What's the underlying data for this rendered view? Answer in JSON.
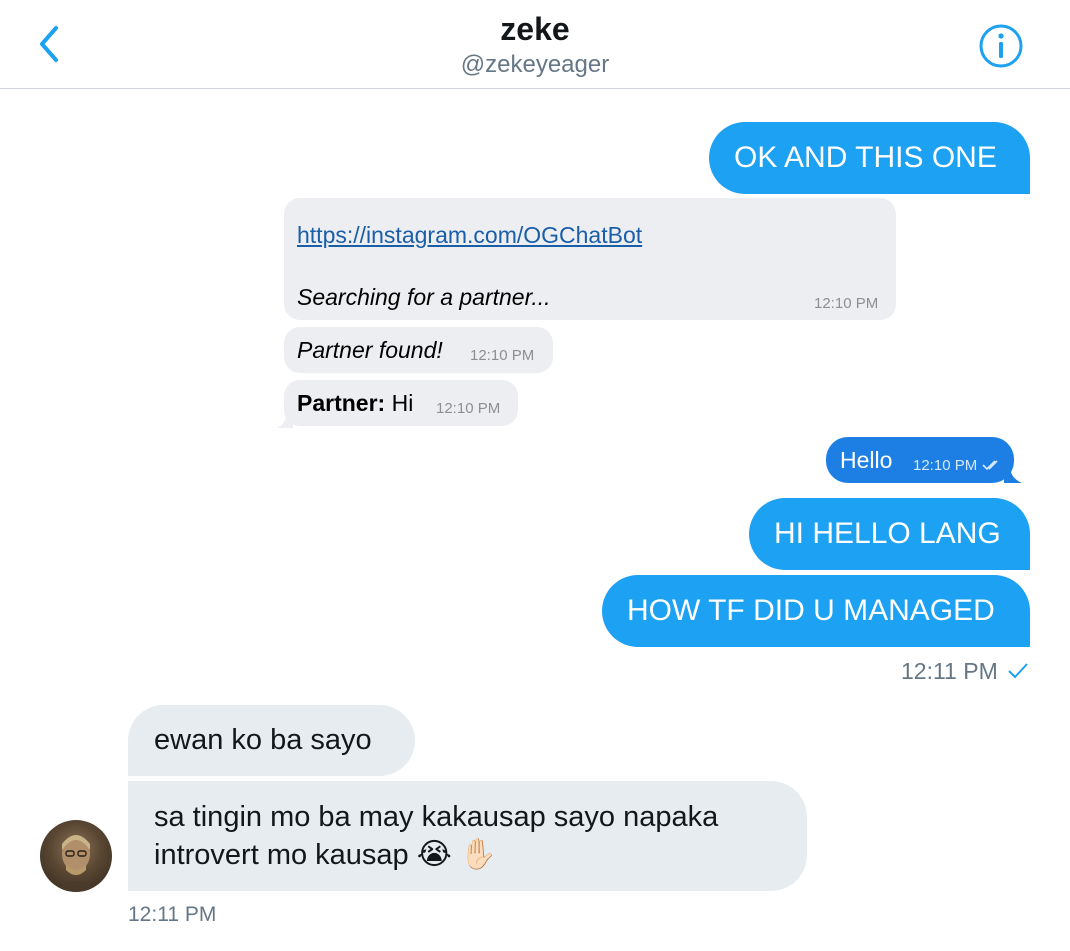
{
  "header": {
    "title": "zeke",
    "handle": "@zekeyeager",
    "back_icon": "chevron-left-icon",
    "info_icon": "info-icon"
  },
  "messages": {
    "m1": "OK AND THIS ONE",
    "tg_link": "https://instagram.com/OGChatBot",
    "tg_searching": "Searching for a partner...",
    "tg_time1": "12:10 PM",
    "tg_found": "Partner found!",
    "tg_time2": "12:10 PM",
    "tg_partner_label": "Partner:",
    "tg_partner_text": "Hi",
    "tg_time3": "12:10 PM",
    "tg_hello": "Hello",
    "tg_time4": "12:10 PM",
    "m2": "HI HELLO LANG",
    "m3": "HOW TF DID U MANAGED",
    "sent_time": "12:11 PM",
    "r1": "ewan ko ba sayo",
    "r2_line1": "sa tingin mo ba may kakausap sayo napaka",
    "r2_line2": "introvert mo kausap",
    "r2_emoji1": "😭",
    "r2_emoji2": "✋🏻",
    "recv_time": "12:11 PM"
  },
  "colors": {
    "accent": "#1da1f2",
    "received_bg": "#e6ecf0",
    "muted": "#657786"
  }
}
